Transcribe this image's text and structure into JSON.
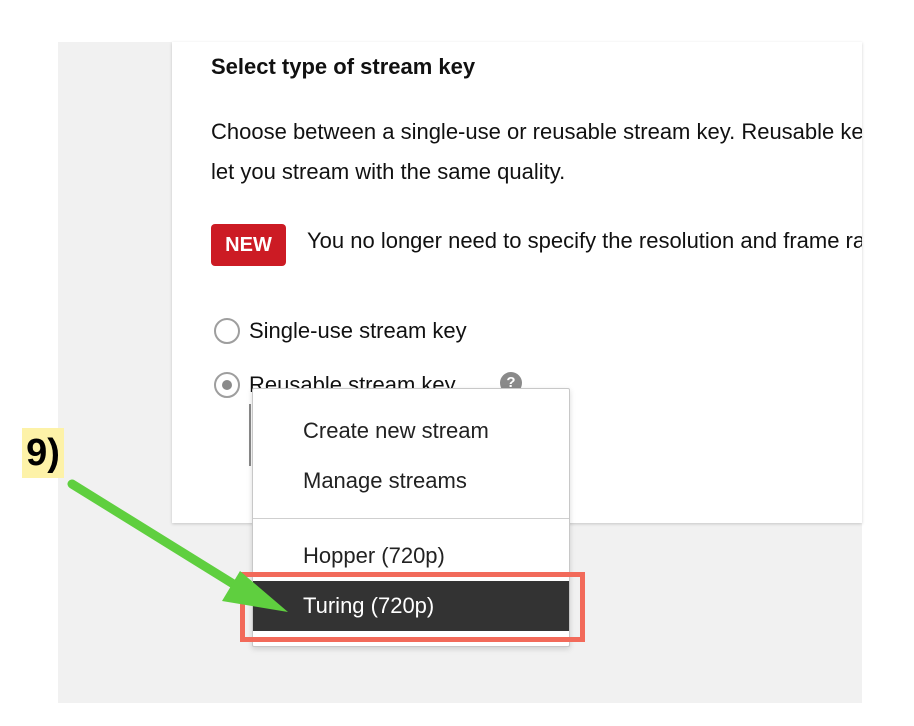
{
  "section": {
    "heading": "Select type of stream key",
    "description": "Choose between a single-use or reusable stream key. Reusable keys let you stream with the same quality.",
    "new_badge": "NEW",
    "new_message": "You no longer need to specify the resolution and frame rate"
  },
  "options": {
    "single_use_label": "Single-use stream key",
    "reusable_label": "Reusable stream key",
    "help_icon_glyph": "?",
    "selected": "reusable"
  },
  "dropdown": {
    "actions": [
      "Create new stream",
      "Manage streams"
    ],
    "streams": [
      "Hopper (720p)",
      "Turing (720p)"
    ],
    "selected_stream": "Turing (720p)"
  },
  "annotation": {
    "step_label": "9)",
    "highlight_color": "#f26a5a",
    "arrow_color": "#5fcf3f",
    "step_label_bg": "#fdf2a8"
  },
  "colors": {
    "badge": "#cc1b24",
    "selected_item_bg": "#333333",
    "panel_bg": "#f1f1f1"
  }
}
